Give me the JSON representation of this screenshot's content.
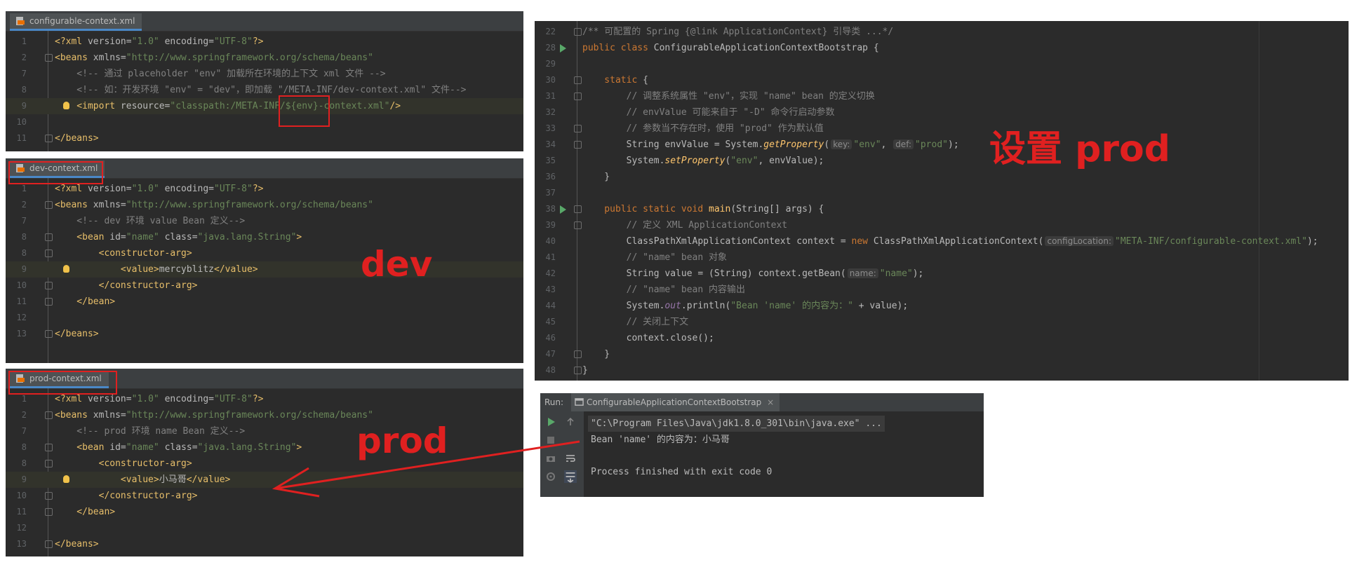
{
  "configurable_panel": {
    "tab": "configurable-context.xml",
    "lines": [
      {
        "n": "1",
        "parts": [
          [
            "tg",
            "<?xml "
          ],
          [
            "at",
            "version="
          ],
          [
            "av",
            "\"1.0\" "
          ],
          [
            "at",
            "encoding="
          ],
          [
            "av",
            "\"UTF-8\""
          ],
          [
            "tg",
            "?>"
          ]
        ]
      },
      {
        "n": "2",
        "parts": [
          [
            "tg",
            "<beans "
          ],
          [
            "at",
            "xmlns="
          ],
          [
            "av",
            "\"http://www.springframework.org/schema/beans\""
          ]
        ]
      },
      {
        "n": "7",
        "parts": [
          [
            "cm",
            "    <!-- 通过 placeholder \"env\" 加载所在环境的上下文 xml 文件 -->"
          ]
        ]
      },
      {
        "n": "8",
        "parts": [
          [
            "cm",
            "    <!-- 如：开发环境 \"env\" = \"dev\"，即加载 \"/META-INF/dev-context.xml\" 文件-->"
          ]
        ]
      },
      {
        "n": "9",
        "parts": [
          [
            "tg",
            "    <import "
          ],
          [
            "at",
            "resource="
          ],
          [
            "av",
            "\"classpath:/META-INF/${env}-context.xml\""
          ],
          [
            "tg",
            "/>"
          ]
        ]
      },
      {
        "n": "10",
        "parts": []
      },
      {
        "n": "11",
        "parts": [
          [
            "tg",
            "</beans>"
          ]
        ]
      }
    ]
  },
  "dev_panel": {
    "tab": "dev-context.xml",
    "lines": [
      {
        "n": "1",
        "parts": [
          [
            "tg",
            "<?xml "
          ],
          [
            "at",
            "version="
          ],
          [
            "av",
            "\"1.0\" "
          ],
          [
            "at",
            "encoding="
          ],
          [
            "av",
            "\"UTF-8\""
          ],
          [
            "tg",
            "?>"
          ]
        ]
      },
      {
        "n": "2",
        "parts": [
          [
            "tg",
            "<beans "
          ],
          [
            "at",
            "xmlns="
          ],
          [
            "av",
            "\"http://www.springframework.org/schema/beans\""
          ]
        ]
      },
      {
        "n": "7",
        "parts": [
          [
            "cm",
            "    <!-- dev 环境 value Bean 定义-->"
          ]
        ]
      },
      {
        "n": "8",
        "parts": [
          [
            "tg",
            "    <bean "
          ],
          [
            "at",
            "id="
          ],
          [
            "av",
            "\"name\" "
          ],
          [
            "at",
            "class="
          ],
          [
            "av",
            "\"java.lang.String\""
          ],
          [
            "tg",
            ">"
          ]
        ]
      },
      {
        "n": "8",
        "parts": [
          [
            "tg",
            "        <constructor-arg>"
          ]
        ]
      },
      {
        "n": "9",
        "parts": [
          [
            "tg",
            "            <value>"
          ],
          [
            "at",
            "mercyblitz"
          ],
          [
            "tg",
            "</value>"
          ]
        ]
      },
      {
        "n": "10",
        "parts": [
          [
            "tg",
            "        </constructor-arg>"
          ]
        ]
      },
      {
        "n": "11",
        "parts": [
          [
            "tg",
            "    </bean>"
          ]
        ]
      },
      {
        "n": "12",
        "parts": []
      },
      {
        "n": "13",
        "parts": [
          [
            "tg",
            "</beans>"
          ]
        ]
      }
    ]
  },
  "prod_panel": {
    "tab": "prod-context.xml",
    "lines": [
      {
        "n": "1",
        "parts": [
          [
            "tg",
            "<?xml "
          ],
          [
            "at",
            "version="
          ],
          [
            "av",
            "\"1.0\" "
          ],
          [
            "at",
            "encoding="
          ],
          [
            "av",
            "\"UTF-8\""
          ],
          [
            "tg",
            "?>"
          ]
        ]
      },
      {
        "n": "2",
        "parts": [
          [
            "tg",
            "<beans "
          ],
          [
            "at",
            "xmlns="
          ],
          [
            "av",
            "\"http://www.springframework.org/schema/beans\""
          ]
        ]
      },
      {
        "n": "7",
        "parts": [
          [
            "cm",
            "    <!-- prod 环境 name Bean 定义-->"
          ]
        ]
      },
      {
        "n": "8",
        "parts": [
          [
            "tg",
            "    <bean "
          ],
          [
            "at",
            "id="
          ],
          [
            "av",
            "\"name\" "
          ],
          [
            "at",
            "class="
          ],
          [
            "av",
            "\"java.lang.String\""
          ],
          [
            "tg",
            ">"
          ]
        ]
      },
      {
        "n": "8",
        "parts": [
          [
            "tg",
            "        <constructor-arg>"
          ]
        ]
      },
      {
        "n": "9",
        "parts": [
          [
            "tg",
            "            <value>"
          ],
          [
            "at",
            "小马哥"
          ],
          [
            "tg",
            "</value>"
          ]
        ]
      },
      {
        "n": "10",
        "parts": [
          [
            "tg",
            "        </constructor-arg>"
          ]
        ]
      },
      {
        "n": "11",
        "parts": [
          [
            "tg",
            "    </bean>"
          ]
        ]
      },
      {
        "n": "12",
        "parts": []
      },
      {
        "n": "13",
        "parts": [
          [
            "tg",
            "</beans>"
          ]
        ]
      }
    ]
  },
  "java_panel": {
    "lines": [
      {
        "n": "22",
        "parts": [
          [
            "cm",
            "/** 可配置的 Spring {@link ApplicationContext} 引导类 ...*/"
          ]
        ]
      },
      {
        "n": "28",
        "parts": [
          [
            "kw",
            "public class "
          ],
          [
            "at",
            "ConfigurableApplicationContextBootstrap {"
          ]
        ]
      },
      {
        "n": "29",
        "parts": []
      },
      {
        "n": "30",
        "parts": [
          [
            "kw",
            "    static "
          ],
          [
            "at",
            "{"
          ]
        ]
      },
      {
        "n": "31",
        "parts": [
          [
            "cm",
            "        // 调整系统属性 \"env\"，实现 \"name\" bean 的定义切换"
          ]
        ]
      },
      {
        "n": "32",
        "parts": [
          [
            "cm",
            "        // envValue 可能来自于 \"-D\" 命令行启动参数"
          ]
        ]
      },
      {
        "n": "33",
        "parts": [
          [
            "cm",
            "        // 参数当不存在时，使用 \"prod\" 作为默认值"
          ]
        ]
      },
      {
        "n": "34",
        "parts": [
          [
            "at",
            "        String envValue = System."
          ],
          [
            "fni",
            "getProperty"
          ],
          [
            "at",
            "("
          ],
          [
            "hint",
            "key:"
          ],
          [
            "st",
            "\"env\""
          ],
          [
            "at",
            ", "
          ],
          [
            "hint",
            "def:"
          ],
          [
            "st",
            "\"prod\""
          ],
          [
            "at",
            ");"
          ]
        ]
      },
      {
        "n": "35",
        "parts": [
          [
            "at",
            "        System."
          ],
          [
            "fni",
            "setProperty"
          ],
          [
            "at",
            "("
          ],
          [
            "st",
            "\"env\""
          ],
          [
            "at",
            ", envValue);"
          ]
        ]
      },
      {
        "n": "36",
        "parts": [
          [
            "at",
            "    }"
          ]
        ]
      },
      {
        "n": "37",
        "parts": []
      },
      {
        "n": "38",
        "parts": [
          [
            "kw",
            "    public static void "
          ],
          [
            "fn",
            "main"
          ],
          [
            "at",
            "(String[] args) {"
          ]
        ]
      },
      {
        "n": "39",
        "parts": [
          [
            "cm",
            "        // 定义 XML ApplicationContext"
          ]
        ]
      },
      {
        "n": "40",
        "parts": [
          [
            "at",
            "        ClassPathXmlApplicationContext context = "
          ],
          [
            "kw",
            "new "
          ],
          [
            "at",
            "ClassPathXmlApplicationContext("
          ],
          [
            "hint",
            "configLocation:"
          ],
          [
            "st",
            "\"META-INF/configurable-context.xml\""
          ],
          [
            "at",
            ");"
          ]
        ]
      },
      {
        "n": "41",
        "parts": [
          [
            "cm",
            "        // \"name\" bean 对象"
          ]
        ]
      },
      {
        "n": "42",
        "parts": [
          [
            "at",
            "        String value = (String) context.getBean("
          ],
          [
            "hint",
            "name:"
          ],
          [
            "st",
            "\"name\""
          ],
          [
            "at",
            ");"
          ]
        ]
      },
      {
        "n": "43",
        "parts": [
          [
            "cm",
            "        // \"name\" bean 内容输出"
          ]
        ]
      },
      {
        "n": "44",
        "parts": [
          [
            "at",
            "        System."
          ],
          [
            "sf",
            "out"
          ],
          [
            "at",
            ".println("
          ],
          [
            "st",
            "\"Bean 'name' 的内容为：\""
          ],
          [
            "at",
            " + value);"
          ]
        ]
      },
      {
        "n": "45",
        "parts": [
          [
            "cm",
            "        // 关闭上下文"
          ]
        ]
      },
      {
        "n": "46",
        "parts": [
          [
            "at",
            "        context.close();"
          ]
        ]
      },
      {
        "n": "47",
        "parts": [
          [
            "at",
            "    }"
          ]
        ]
      },
      {
        "n": "48",
        "parts": [
          [
            "at",
            "}"
          ]
        ]
      }
    ]
  },
  "run_panel": {
    "label": "Run:",
    "tab": "ConfigurableApplicationContextBootstrap",
    "close": "×",
    "lines": [
      "\"C:\\Program Files\\Java\\jdk1.8.0_301\\bin\\java.exe\" ...",
      "Bean 'name' 的内容为：小马哥",
      "",
      "Process finished with exit code 0"
    ]
  },
  "annotations": {
    "dev": "dev",
    "prod": "prod",
    "set_prod": "设置 prod"
  },
  "colors": {
    "annotation_red": "#e02020",
    "editor_bg": "#2b2b2b"
  }
}
